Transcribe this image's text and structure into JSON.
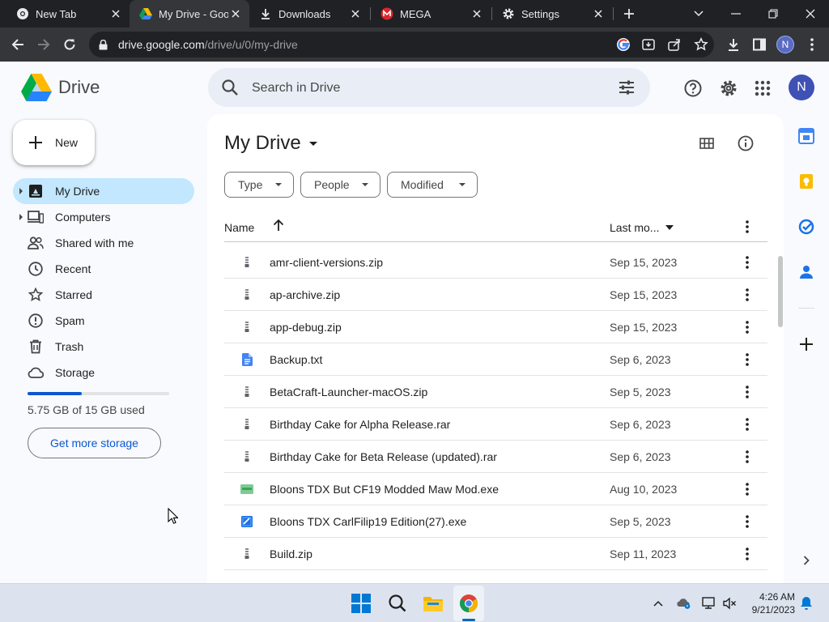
{
  "browser": {
    "tabs": [
      {
        "title": "New Tab"
      },
      {
        "title": "My Drive - Google Drive",
        "active": true
      },
      {
        "title": "Downloads"
      },
      {
        "title": "MEGA"
      },
      {
        "title": "Settings"
      }
    ],
    "address": {
      "host": "drive.google.com",
      "path": "/drive/u/0/my-drive"
    },
    "profile_initial": "N"
  },
  "drive": {
    "app_name": "Drive",
    "search_placeholder": "Search in Drive",
    "avatar_initial": "N",
    "new_label": "New",
    "nav": [
      {
        "label": "My Drive",
        "icon": "my-drive-icon",
        "selected": true,
        "expandable": true
      },
      {
        "label": "Computers",
        "icon": "computers-icon",
        "expandable": true
      },
      {
        "label": "Shared with me",
        "icon": "shared-icon"
      },
      {
        "label": "Recent",
        "icon": "clock-icon"
      },
      {
        "label": "Starred",
        "icon": "star-icon"
      },
      {
        "label": "Spam",
        "icon": "spam-icon"
      },
      {
        "label": "Trash",
        "icon": "trash-icon"
      },
      {
        "label": "Storage",
        "icon": "cloud-icon"
      }
    ],
    "storage": {
      "text": "5.75 GB of 15 GB used",
      "used_fraction": 0.383,
      "cta": "Get more storage"
    },
    "page_title": "My Drive",
    "filters": [
      "Type",
      "People",
      "Modified"
    ],
    "columns": {
      "name": "Name",
      "modified": "Last mo..."
    },
    "files": [
      {
        "name": "amr-client-versions.zip",
        "date": "Sep 15, 2023",
        "icon": "zip-icon"
      },
      {
        "name": "ap-archive.zip",
        "date": "Sep 15, 2023",
        "icon": "zip-icon"
      },
      {
        "name": "app-debug.zip",
        "date": "Sep 15, 2023",
        "icon": "zip-icon"
      },
      {
        "name": "Backup.txt",
        "date": "Sep 6, 2023",
        "icon": "doc-icon"
      },
      {
        "name": "BetaCraft-Launcher-macOS.zip",
        "date": "Sep 5, 2023",
        "icon": "zip-icon"
      },
      {
        "name": "Birthday Cake for Alpha Release.rar",
        "date": "Sep 6, 2023",
        "icon": "zip-icon"
      },
      {
        "name": "Birthday Cake for Beta Release (updated).rar",
        "date": "Sep 6, 2023",
        "icon": "zip-icon"
      },
      {
        "name": "Bloons TDX But CF19 Modded Maw Mod.exe",
        "date": "Aug 10, 2023",
        "icon": "exe-icon"
      },
      {
        "name": "Bloons TDX CarlFilip19 Edition(27).exe",
        "date": "Sep 5, 2023",
        "icon": "image-icon"
      },
      {
        "name": "Build.zip",
        "date": "Sep 11, 2023",
        "icon": "zip-icon"
      }
    ]
  },
  "taskbar": {
    "time": "4:26 AM",
    "date": "9/21/2023"
  },
  "colors": {
    "accent": "#0b57d0",
    "selected": "#c2e7ff",
    "chrome_dark": "#202124"
  }
}
